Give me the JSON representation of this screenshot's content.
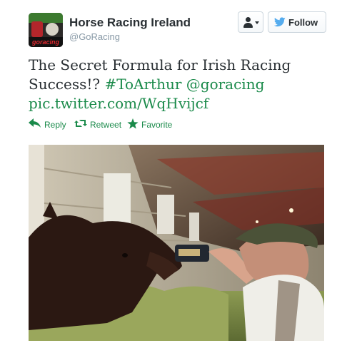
{
  "account": {
    "name": "Horse Racing Ireland",
    "handle": "@GoRacing",
    "avatar_text": "goracing"
  },
  "buttons": {
    "follow_label": "Follow"
  },
  "tweet": {
    "text_plain_1": "The Secret Formula for Irish Racing",
    "text_plain_2": "Success!? ",
    "hashtag": "#ToArthur",
    "mention": " @goracing",
    "link": "pic.twitter.com/WqHvijcf"
  },
  "actions": {
    "reply": "Reply",
    "retweet": "Retweet",
    "favorite": "Favorite"
  },
  "icons": {
    "user_menu": "user-dropdown-icon",
    "follow": "twitter-bird-icon",
    "reply": "reply-arrow-icon",
    "retweet": "retweet-icon",
    "favorite": "star-icon"
  },
  "colors": {
    "link": "#1a8a4a",
    "twitter_blue": "#55acee",
    "text": "#292f33",
    "muted": "#8899a6"
  }
}
